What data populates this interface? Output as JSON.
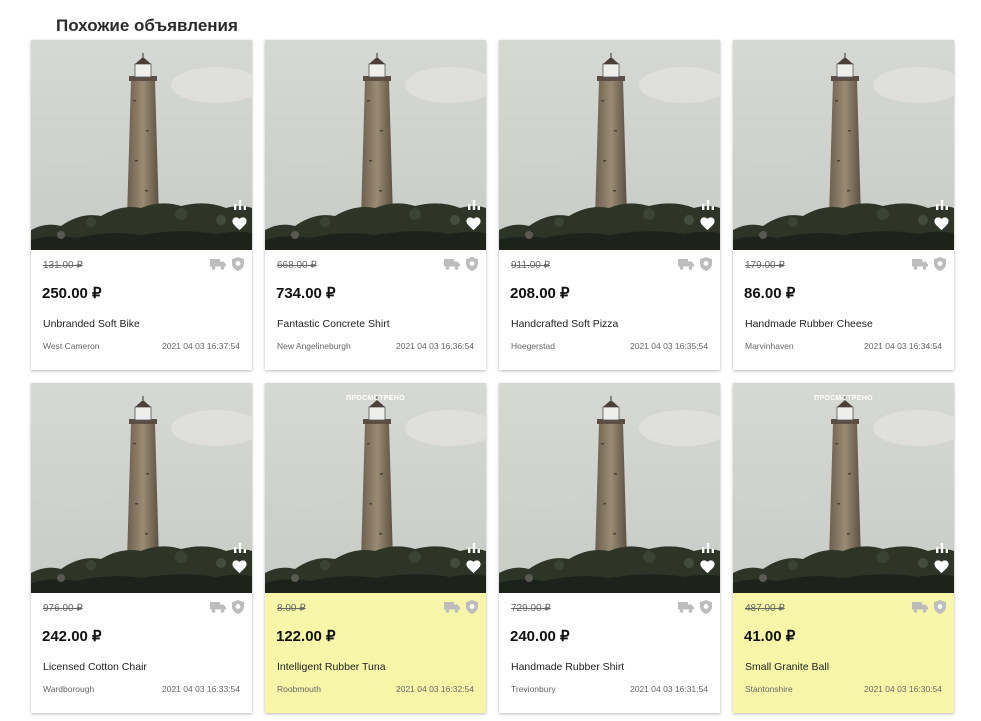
{
  "section": {
    "title": "Похожие объявления"
  },
  "viewed_label": "ПРОСМОТРЕНО",
  "icons": {
    "stats": "bar-chart-icon",
    "favorite": "heart-icon",
    "delivery": "truck-icon",
    "safe_deal": "shield-icon"
  },
  "colors": {
    "viewed_background": "#f7f6a8",
    "card_background": "#ffffff"
  },
  "listings": [
    {
      "old_price": "131.00 ₽",
      "price": "250.00 ₽",
      "title": "Unbranded Soft Bike",
      "city": "West Cameron",
      "date": "2021 04 03 16:37:54",
      "viewed": false
    },
    {
      "old_price": "668.00 ₽",
      "price": "734.00 ₽",
      "title": "Fantastic Concrete Shirt",
      "city": "New Angelineburgh",
      "date": "2021 04 03 16:36:54",
      "viewed": false
    },
    {
      "old_price": "911.00 ₽",
      "price": "208.00 ₽",
      "title": "Handcrafted Soft Pizza",
      "city": "Hoegerstad",
      "date": "2021 04 03 16:35:54",
      "viewed": false
    },
    {
      "old_price": "179.00 ₽",
      "price": "86.00 ₽",
      "title": "Handmade Rubber Cheese",
      "city": "Marvinhaven",
      "date": "2021 04 03 16:34:54",
      "viewed": false
    },
    {
      "old_price": "976.00 ₽",
      "price": "242.00 ₽",
      "title": "Licensed Cotton Chair",
      "city": "Wardborough",
      "date": "2021 04 03 16:33:54",
      "viewed": false
    },
    {
      "old_price": "8.00 ₽",
      "price": "122.00 ₽",
      "title": "Intelligent Rubber Tuna",
      "city": "Roobmouth",
      "date": "2021 04 03 16:32:54",
      "viewed": true
    },
    {
      "old_price": "729.00 ₽",
      "price": "240.00 ₽",
      "title": "Handmade Rubber Shirt",
      "city": "Trevionbury",
      "date": "2021 04 03 16:31:54",
      "viewed": false
    },
    {
      "old_price": "487.00 ₽",
      "price": "41.00 ₽",
      "title": "Small Granite Ball",
      "city": "Stantonshire",
      "date": "2021 04 03 16:30:54",
      "viewed": true
    }
  ]
}
